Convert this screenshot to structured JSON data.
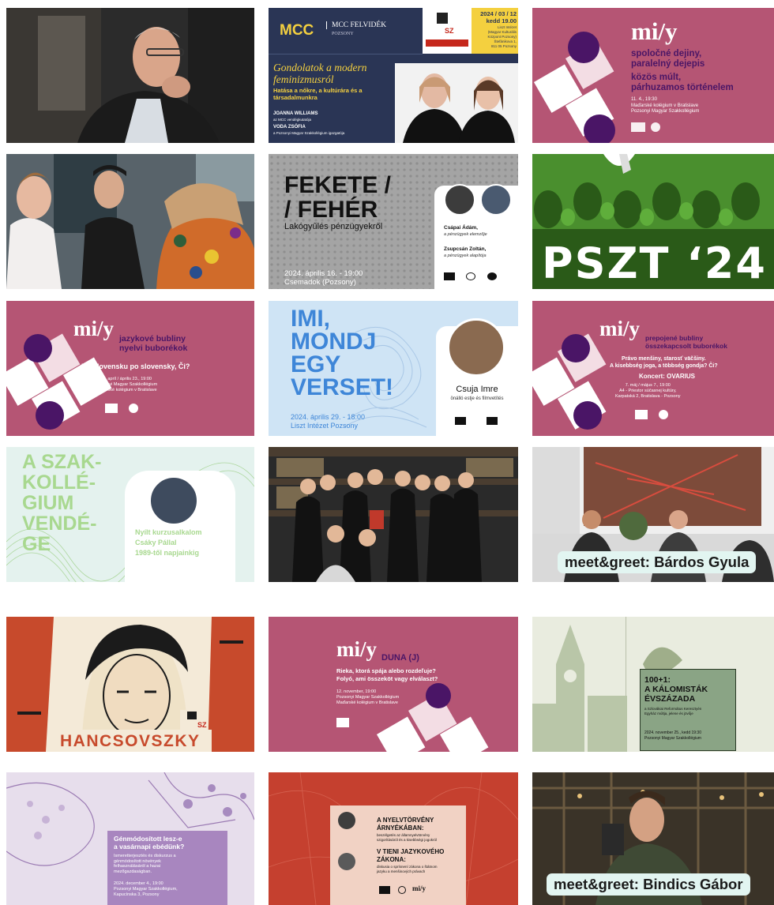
{
  "colors": {
    "miy_pink": "#b55574",
    "miy_purple": "#4a1566",
    "mcc_navy": "#2a3555",
    "mcc_yellow": "#f4d03f",
    "gray_bg": "#9c9c9c",
    "green_bg": "#4a8f2e",
    "light_blue": "#cfe4f5",
    "mint": "#e4f2ee",
    "pill_bg": "#e2f5f1",
    "red_bg": "#c5402f"
  },
  "tiles": {
    "t1": {
      "icon": "portrait-photo"
    },
    "t2": {
      "logo": "MCC",
      "org": "MCC FELVIDÉK",
      "org_sub": "POZSONY",
      "date": "2024 / 03 / 12\nkedd 19.00",
      "venue": "Liszt Intézet\n(Magyar Kulturális\nKözpont Pozsony)\nŠtefánikova 1,\n811 05 Pozsony",
      "title": "Gondolatok a modern\nfeminizmusról",
      "subtitle": "Hatása a nőkre, a kultúrára és a\ntársadalmunkra",
      "speaker1": "JOANNA WILLIAMS",
      "speaker1_role": "az MCC vendégkutatója",
      "speaker2": "VODA ZSÓFIA",
      "speaker2_role": "a Pozsonyi Magyar Szakkollégium igazgatója"
    },
    "t3": {
      "brand": "mi/y",
      "line1": "spoločné dejiny,\nparalelný dejepis",
      "line2": "közös múlt,\npárhuzamos történelem",
      "details": "11. 4., 19:30\nMaďarské kolégium v Bratislave\nPozsonyi Magyar Szakkollégium"
    },
    "t4": {
      "icon": "discussion-photo"
    },
    "t5": {
      "title": "FEKETE /\n/ FEHÉR",
      "subtitle": "Lakógyűlés pénzügyekről",
      "date": "2024. április 16. - 19:00\nCsemadok (Pozsony)",
      "guest1": "Csápai Ádám,",
      "guest1_role": "a pénzügyek elemzője",
      "guest2": "Zsupcsán Zoltán,",
      "guest2_role": "a pénzügyek alapítója"
    },
    "t6": {
      "text": "PSZT ‘24"
    },
    "t7": {
      "brand": "mi/y",
      "line1": "jazykové bubliny\nnyelvi buborékok",
      "question": "Na Slovensku po slovensky, Či?",
      "details": "23. apríl / április 23., 19:00\nPozsonyi Magyar Szakkollégium\nMaďarské kolégium v Bratislave"
    },
    "t8": {
      "title": "IMI,\nMONDJ\nEGY\nVERSET!",
      "date": "2024. április 29. - 18:00\nLiszt Intézet Pozsony",
      "guest": "Csuja Imre",
      "guest_role": "önálló estje és filmvetítés"
    },
    "t9": {
      "brand": "mi/y",
      "line1": "prepojené bubliny\nösszekapcsolt buborékok",
      "question": "Právo menšiny, starosť väčšiny.\nA kisebbség joga, a többség gondja? Či?",
      "concert": "Koncert: OVARIUS",
      "details": "7. máj / május 7., 19:00\nA4 - Priestor súčasnej kultúry,\nKarpatská 2, Bratislava - Pozsony"
    },
    "t10": {
      "title": "A SZAK-\nKOLLÉ-\nGIUM\nVENDÉ-\nGE",
      "info": "Nyílt kurzusalkalom\nCsáky Pállal\n1989-től napjainkig"
    },
    "t11": {
      "icon": "group-photo"
    },
    "t12": {
      "label": "meet&greet: Bárdos Gyula"
    },
    "t13": {
      "title": "HANCSOVSZKY",
      "logo_text": "SZ"
    },
    "t14": {
      "brand": "mi/y",
      "brand_tag": "DUNA (J)",
      "question": "Rieka, ktorá spája alebo rozdeľuje?\nFolyó, ami összeköt vagy elválaszt?",
      "details": "12. november, 19:00\nPozsonyi Magyar Szakkollégium\nMaďarské kolégium v Bratislave"
    },
    "t15": {
      "title": "100+1:\nA KÁLOMISTÁK\nÉVSZÁZADA",
      "subtitle": "a Szlovákiai Református Keresztyén\nEgyház múltja, jelene és jövője",
      "date": "2024. november 25., kedd 19:30\nPozsonyi Magyar Szakkollégium"
    },
    "t16": {
      "title": "Génmódosított lesz-e\na vasárnapi ebédünk?",
      "subtitle": "Ismeretterjesztés és diskurzus a\ngénmódosított növények\nfelhasználásáról a hazai\nmezőgazdaságban.",
      "date": "2024. december 4., 19:00\nPozsonyi Magyar Szakkollégium,\nKapucínska 3, Pozsony"
    },
    "t17": {
      "title1": "A NYELVTÖRVÉNY\nÁRNYÉKÁBAN:",
      "sub1": "beszélgetés az államnyelvtörvény\nszigorításáról és a kisebbségi jogokról",
      "title2": "V TIENI JAZYKOVÉHO\nZÁKONA:",
      "sub2": "diskusia o sprísnení zákona o štátnom\njazyku a menšinových právach",
      "brand": "mi/y"
    },
    "t18": {
      "label": "meet&greet: Bindics Gábor"
    }
  }
}
